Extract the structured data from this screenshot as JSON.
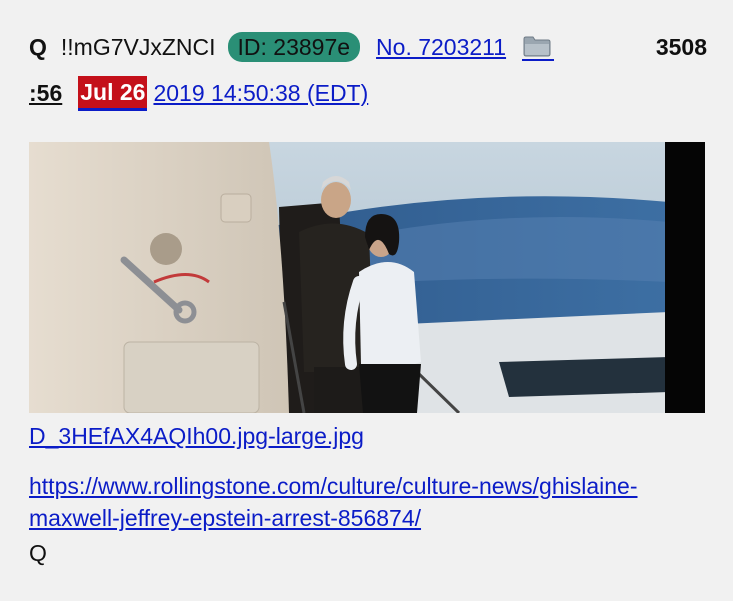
{
  "post": {
    "author": "Q",
    "tripcode": "!!mG7VJxZNCI",
    "id_badge": "ID: 23897e",
    "post_number": "No. 7203211",
    "thread_number_part1": "3508",
    "thread_number_part2": ":56",
    "date_highlight": "Jul 26",
    "timestamp": "2019 14:50:38 (EDT)",
    "image": {
      "filename": "D_3HEfAX4AQIh00.jpg-large.jpg"
    },
    "link": "https://www.rollingstone.com/culture/culture-news/ghislaine-maxwell-jeffrey-epstein-arrest-856874/",
    "signature": "Q"
  },
  "colors": {
    "background": "#f1f1f1",
    "link": "#0b1cc7",
    "id_badge": "#2a8f76",
    "date_highlight": "#c4101a"
  },
  "icons": {
    "folder": "folder-icon"
  }
}
